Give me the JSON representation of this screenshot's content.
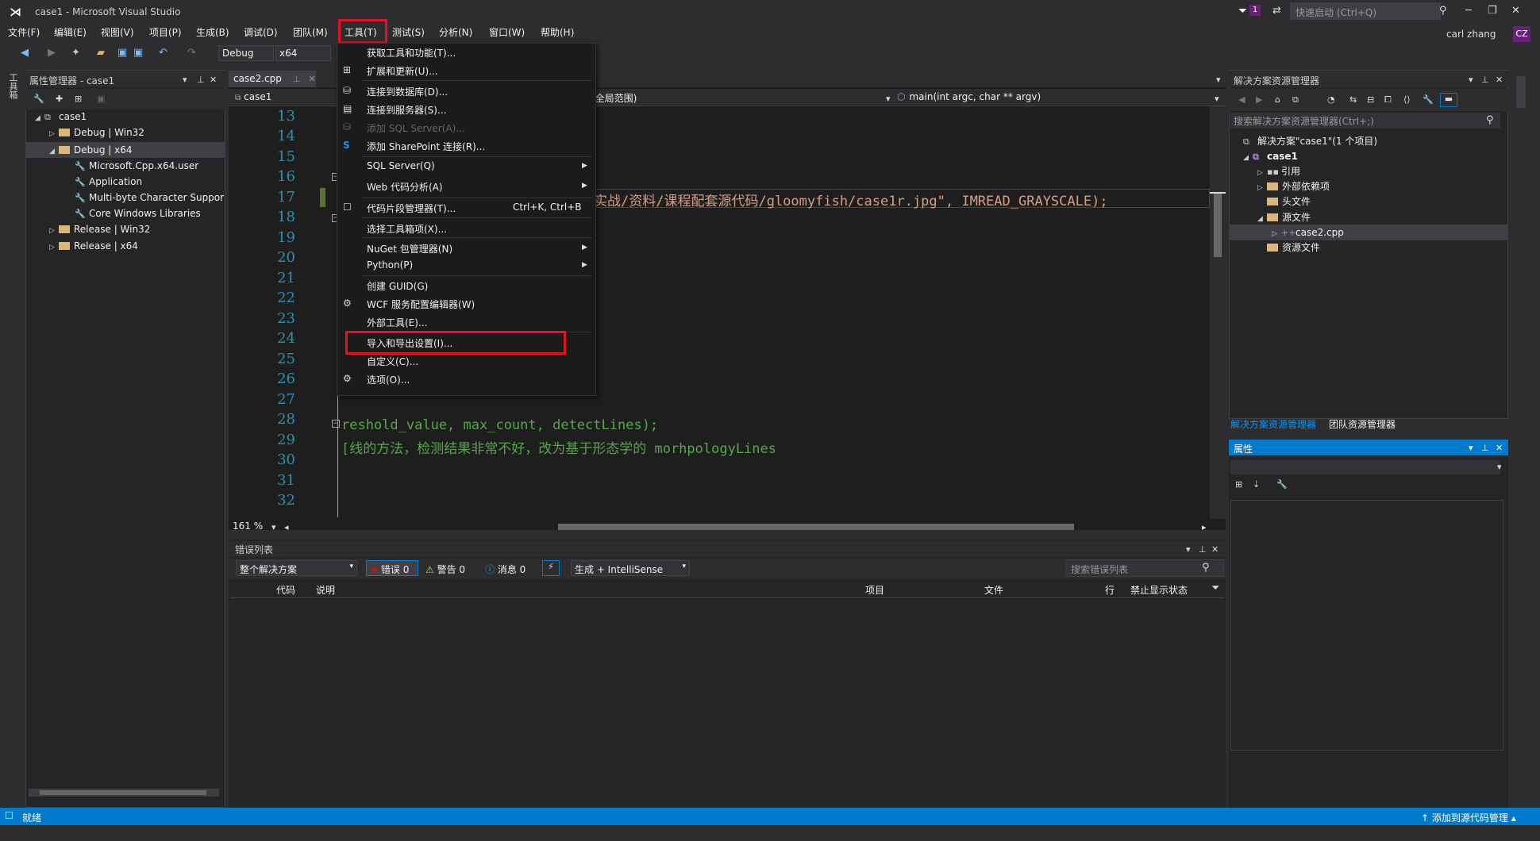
{
  "app": {
    "title": "case1 - Microsoft Visual Studio",
    "notif_count": "1",
    "quick_launch_placeholder": "快速启动 (Ctrl+Q)",
    "user_name": "carl zhang",
    "user_initials": "CZ"
  },
  "menubar": [
    "文件(F)",
    "编辑(E)",
    "视图(V)",
    "项目(P)",
    "生成(B)",
    "调试(D)",
    "团队(M)",
    "工具(T)",
    "测试(S)",
    "分析(N)",
    "窗口(W)",
    "帮助(H)"
  ],
  "toolbar": {
    "config": "Debug",
    "platform": "x64"
  },
  "left_strip_label": "工具箱",
  "prop_manager": {
    "title": "属性管理器 - case1",
    "tree": [
      "case1",
      "Debug | Win32",
      "Debug | x64",
      "Microsoft.Cpp.x64.user",
      "Application",
      "Multi-byte Character Suppor",
      "Core Windows Libraries",
      "Release | Win32",
      "Release | x64"
    ]
  },
  "editor": {
    "tab": "case2.cpp",
    "nav_project": "case1",
    "nav_scope": "(全局范围)",
    "nav_func": "main(int argc, char ** argv)",
    "line_numbers": [
      "13",
      "14",
      "15",
      "16",
      "17",
      "18",
      "19",
      "20",
      "21",
      "22",
      "23",
      "24",
      "25",
      "26",
      "27",
      "28",
      "29",
      "30",
      "31",
      "32"
    ],
    "code_17": "实战/资料/课程配套源代码/gloomyfish/case1r.jpg\", IMREAD_GRAYSCALE);",
    "code_28": "reshold_value, max_count, detectLines);",
    "code_29": "[线的方法，检测结果非常不好，改为基于形态学的 morhpologyLines",
    "zoom": "161 %"
  },
  "tools_menu": {
    "items": [
      {
        "label": "获取工具和功能(T)..."
      },
      {
        "label": "扩展和更新(U)..."
      },
      {
        "label": "连接到数据库(D)..."
      },
      {
        "label": "连接到服务器(S)..."
      },
      {
        "label": "添加 SQL Server(A)..."
      },
      {
        "label": "添加 SharePoint 连接(R)..."
      },
      {
        "label": "SQL Server(Q)"
      },
      {
        "label": "Web 代码分析(A)"
      },
      {
        "label": "代码片段管理器(T)...",
        "shortcut": "Ctrl+K, Ctrl+B"
      },
      {
        "label": "选择工具箱项(X)..."
      },
      {
        "label": "NuGet 包管理器(N)"
      },
      {
        "label": "Python(P)"
      },
      {
        "label": "创建 GUID(G)"
      },
      {
        "label": "WCF 服务配置编辑器(W)"
      },
      {
        "label": "外部工具(E)..."
      },
      {
        "label": "导入和导出设置(I)..."
      },
      {
        "label": "自定义(C)..."
      },
      {
        "label": "选项(O)..."
      }
    ]
  },
  "error_list": {
    "title": "错误列表",
    "scope": "整个解决方案",
    "errors": "错误 0",
    "warnings": "警告 0",
    "messages": "消息 0",
    "build_filter": "生成 + IntelliSense",
    "search_placeholder": "搜索错误列表",
    "columns": [
      "代码",
      "说明",
      "项目",
      "文件",
      "行",
      "禁止显示状态"
    ]
  },
  "solution_explorer": {
    "title": "解决方案资源管理器",
    "search_placeholder": "搜索解决方案资源管理器(Ctrl+;)",
    "tree": [
      "解决方案\"case1\"(1 个项目)",
      "case1",
      "引用",
      "外部依赖项",
      "头文件",
      "源文件",
      "case2.cpp",
      "资源文件"
    ],
    "tab_active": "解决方案资源管理器",
    "tab_team": "团队资源管理器"
  },
  "properties": {
    "title": "属性"
  },
  "status_bar": {
    "text": "就绪",
    "source_control": "添加到源代码管理"
  }
}
